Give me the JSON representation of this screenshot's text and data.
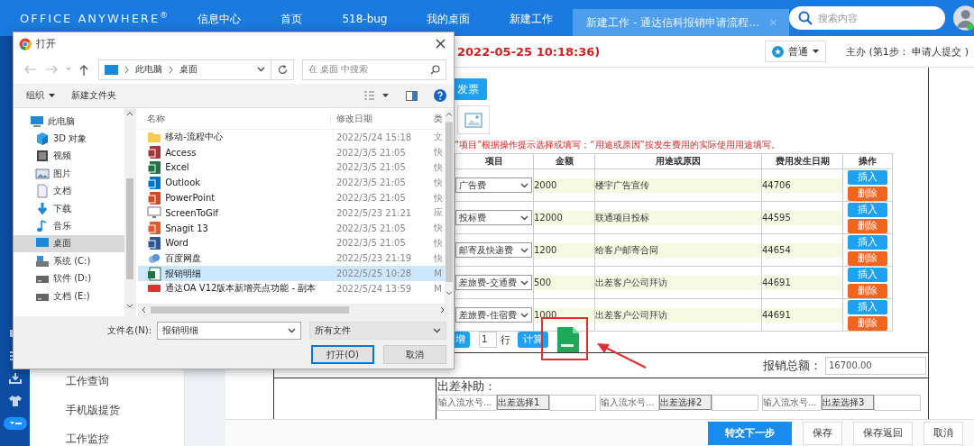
{
  "header": {
    "logo": "OFFICE ANYWHERE$^{®}$",
    "tabs": [
      {
        "label": "信息中心",
        "selected": false
      },
      {
        "label": "首页",
        "selected": false
      },
      {
        "label": "518-bug",
        "selected": false
      },
      {
        "label": "我的桌面",
        "selected": false
      },
      {
        "label": "新建工作",
        "selected": false
      },
      {
        "label": "新建工作 - 通达信科报销申请流程...",
        "selected": true,
        "close": "×"
      }
    ],
    "search": {
      "placeholder": "搜索内容"
    }
  },
  "sidebar": {
    "items": [
      "工作查询",
      "手机版提货",
      "工作监控"
    ]
  },
  "form": {
    "timestamp": "2022-05-25 10:18:36)",
    "priority": "普通",
    "step": "主办 (第1步： 申请人提交 )",
    "invoice_button": "发票",
    "note": "“项目”根据操作提示选择或填写；“用途或原因”按发生费用的实际使用用途填写。",
    "columns": [
      "项目",
      "金额",
      "用途或原因",
      "费用发生日期",
      "操作"
    ],
    "rows": [
      {
        "item": "广告费",
        "amount": "2000",
        "reason": "楼宇广告宣传",
        "date": "44706",
        "actions": [
          "插入",
          "删除"
        ]
      },
      {
        "item": "投标费",
        "amount": "12000",
        "reason": "联通项目投标",
        "date": "44595",
        "actions": [
          "插入",
          "删除"
        ]
      },
      {
        "item": "邮寄及快递费",
        "amount": "1200",
        "reason": "给客户邮寄合同",
        "date": "44654",
        "actions": [
          "插入",
          "删除"
        ]
      },
      {
        "item": "差旅费-交通费",
        "amount": "500",
        "reason": "出差客户公司拜访",
        "date": "44691",
        "actions": [
          "插入",
          "删除"
        ]
      },
      {
        "item": "差旅费-住宿费",
        "amount": "1000",
        "reason": "出差客户公司拜访",
        "date": "44691",
        "actions": [
          "插入",
          "删除"
        ]
      }
    ],
    "add_button": "增",
    "row_count": "1",
    "row_unit": "行",
    "calc_button": "计算",
    "total_label": "报销总额：",
    "total": "16700.00",
    "allowance": {
      "label": "出差补助：",
      "groups": [
        {
          "placeholder": "输入流水号...",
          "button": "出差选择1"
        },
        {
          "placeholder": "输入流水号...",
          "button": "出差选择2"
        },
        {
          "placeholder": "输入流水号...",
          "button": "出差选择3"
        }
      ]
    }
  },
  "actions": [
    {
      "label": "转交下一步",
      "kind": "primary"
    },
    {
      "label": "保存",
      "kind": "normal"
    },
    {
      "label": "保存返回",
      "kind": "normal"
    },
    {
      "label": "取消",
      "kind": "normal"
    }
  ],
  "dialog": {
    "title": "打开",
    "path": [
      "此电脑",
      "桌面"
    ],
    "search": {
      "placeholder": "在 桌面 中搜索"
    },
    "organize": "组织",
    "new_folder": "新建文件夹",
    "nav": [
      {
        "label": "此电脑",
        "kind": "pc",
        "selected": false,
        "children": [
          {
            "label": "3D 对象",
            "kind": "cube",
            "selected": false
          },
          {
            "label": "视频",
            "kind": "video",
            "selected": false
          },
          {
            "label": "图片",
            "kind": "picture",
            "selected": false
          },
          {
            "label": "文档",
            "kind": "document",
            "selected": false
          },
          {
            "label": "下载",
            "kind": "download",
            "selected": false
          },
          {
            "label": "音乐",
            "kind": "music",
            "selected": false
          },
          {
            "label": "桌面",
            "kind": "desktop",
            "selected": true
          },
          {
            "label": "系统 (C:)",
            "kind": "system",
            "selected": false
          },
          {
            "label": "软件 (D:)",
            "kind": "drive",
            "selected": false
          },
          {
            "label": "文档 (E:)",
            "kind": "drive",
            "selected": false
          }
        ]
      }
    ],
    "columns": [
      "名称",
      "修改日期",
      "类"
    ],
    "files": [
      {
        "name": "移动-流程中心",
        "date": "2022/5/24 15:18",
        "type": "文",
        "kind": "folder",
        "selected": false
      },
      {
        "name": "Access",
        "date": "2022/3/5 21:05",
        "type": "快",
        "kind": "app",
        "color": "#a4373a",
        "selected": false
      },
      {
        "name": "Excel",
        "date": "2022/3/5 21:05",
        "type": "快",
        "kind": "app",
        "color": "#217346",
        "selected": false
      },
      {
        "name": "Outlook",
        "date": "2022/3/5 21:05",
        "type": "快",
        "kind": "app",
        "color": "#0072c6",
        "selected": false
      },
      {
        "name": "PowerPoint",
        "date": "2022/3/5 21:05",
        "type": "快",
        "kind": "app",
        "color": "#d24726",
        "selected": false
      },
      {
        "name": "ScreenToGif",
        "date": "2022/5/23 21:21",
        "type": "应",
        "kind": "screen",
        "selected": false
      },
      {
        "name": "Snagit 13",
        "date": "2022/3/5 21:05",
        "type": "快",
        "kind": "app",
        "color": "#e05a2a",
        "selected": false
      },
      {
        "name": "Word",
        "date": "2022/3/5 21:05",
        "type": "快",
        "kind": "app",
        "color": "#2b579a",
        "selected": false
      },
      {
        "name": "百度网盘",
        "date": "2022/5/23 21:19",
        "type": "快",
        "kind": "cloud",
        "selected": false
      },
      {
        "name": "报销明细",
        "date": "2022/5/25 10:28",
        "type": "M",
        "kind": "sheet",
        "selected": true
      },
      {
        "name": "通达OA V12版本新增亮点功能 - 副本",
        "date": "2022/5/24 13:59",
        "type": "M",
        "kind": "pdf",
        "selected": false
      }
    ],
    "filename_label": "文件名(N):",
    "filename": "报销明细",
    "filter": "所有文件",
    "buttons": [
      {
        "label": "打开(O)",
        "kind": "default"
      },
      {
        "label": "取消",
        "kind": "normal"
      }
    ]
  }
}
